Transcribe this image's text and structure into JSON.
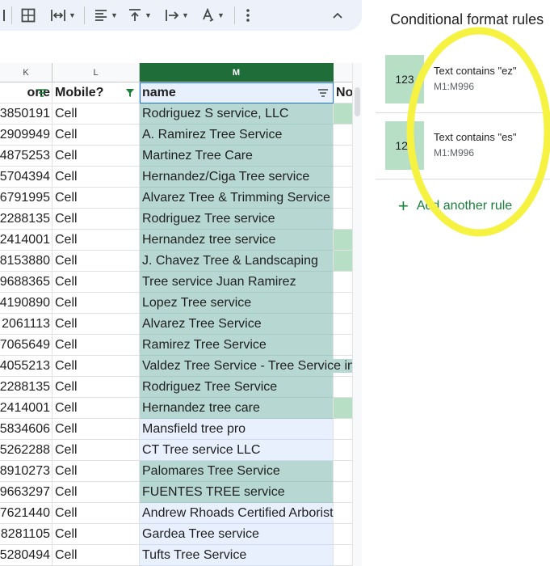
{
  "toolbar": {
    "icons": [
      "borders-icon",
      "merge-cells-icon",
      "horizontal-align-icon",
      "vertical-align-icon",
      "text-wrap-icon",
      "text-rotation-icon",
      "more-vert-icon",
      "collapse-toolbar-icon"
    ]
  },
  "columns": {
    "k": "K",
    "l": "L",
    "m": "M"
  },
  "header_row": {
    "k": "one",
    "l": "Mobile?",
    "m": "name",
    "n": "No"
  },
  "rows": [
    {
      "k": "3850191",
      "l": "Cell",
      "m": "Rodriguez S service, LLC",
      "hl": true,
      "nhl": true
    },
    {
      "k": "2909949",
      "l": "Cell",
      "m": "A. Ramirez Tree Service",
      "hl": true,
      "nhl": false
    },
    {
      "k": "4875253",
      "l": "Cell",
      "m": "Martinez Tree Care",
      "hl": true,
      "nhl": false
    },
    {
      "k": "5704394",
      "l": "Cell",
      "m": "Hernandez/Ciga Tree service",
      "hl": true,
      "nhl": false
    },
    {
      "k": "6791995",
      "l": "Cell",
      "m": "Alvarez Tree & Trimming Service",
      "hl": true,
      "nhl": false
    },
    {
      "k": "2288135",
      "l": "Cell",
      "m": "Rodriguez Tree service",
      "hl": true,
      "nhl": false
    },
    {
      "k": "2414001",
      "l": "Cell",
      "m": "Hernandez tree service",
      "hl": true,
      "nhl": true
    },
    {
      "k": "8153880",
      "l": "Cell",
      "m": "J. Chavez Tree & Landscaping",
      "hl": true,
      "nhl": true
    },
    {
      "k": "9688365",
      "l": "Cell",
      "m": "Tree service Juan Ramirez",
      "hl": true,
      "nhl": false
    },
    {
      "k": "4190890",
      "l": "Cell",
      "m": "Lopez Tree service",
      "hl": true,
      "nhl": false
    },
    {
      "k": "2061113",
      "l": "Cell",
      "m": "Alvarez Tree Service",
      "hl": true,
      "nhl": false
    },
    {
      "k": "7065649",
      "l": "Cell",
      "m": "Ramirez Tree Service",
      "hl": true,
      "nhl": false
    },
    {
      "k": "4055213",
      "l": "Cell",
      "m": "Valdez Tree Service - Tree Service in",
      "hl": true,
      "nhl": false
    },
    {
      "k": "2288135",
      "l": "Cell",
      "m": "Rodriguez Tree Service",
      "hl": true,
      "nhl": false
    },
    {
      "k": "2414001",
      "l": "Cell",
      "m": "Hernandez tree care",
      "hl": true,
      "nhl": true
    },
    {
      "k": "5834606",
      "l": "Cell",
      "m": "Mansfield tree pro",
      "hl": false,
      "nhl": false
    },
    {
      "k": "5262288",
      "l": "Cell",
      "m": "CT Tree service LLC",
      "hl": false,
      "nhl": false
    },
    {
      "k": "8910273",
      "l": "Cell",
      "m": "Palomares Tree Service",
      "hl": true,
      "nhl": false
    },
    {
      "k": "9663297",
      "l": "Cell",
      "m": "FUENTES TREE service",
      "hl": true,
      "nhl": false
    },
    {
      "k": "7621440",
      "l": "Cell",
      "m": "Andrew Rhoads Certified Arborist",
      "hl": false,
      "nhl": false
    },
    {
      "k": "8281105",
      "l": "Cell",
      "m": "Gardea Tree service",
      "hl": false,
      "nhl": false
    },
    {
      "k": "5280494",
      "l": "Cell",
      "m": "Tufts Tree Service",
      "hl": false,
      "nhl": false
    }
  ],
  "panel": {
    "title": "Conditional format rules",
    "rules": [
      {
        "preview": "123",
        "condition": "Text contains \"ez\"",
        "range": "M1:M996"
      },
      {
        "preview": "123",
        "condition": "Text contains \"es\"",
        "range": "M1:M996"
      }
    ],
    "add_rule_label": "Add another rule"
  },
  "colors": {
    "highlight_teal": "#b7d7d2",
    "highlight_green": "#b7dfc6",
    "selected_column_header": "#1f6e3a",
    "selection_blue": "#e8f0fe",
    "annotation_yellow": "#f6f242",
    "add_rule_green": "#188038"
  }
}
